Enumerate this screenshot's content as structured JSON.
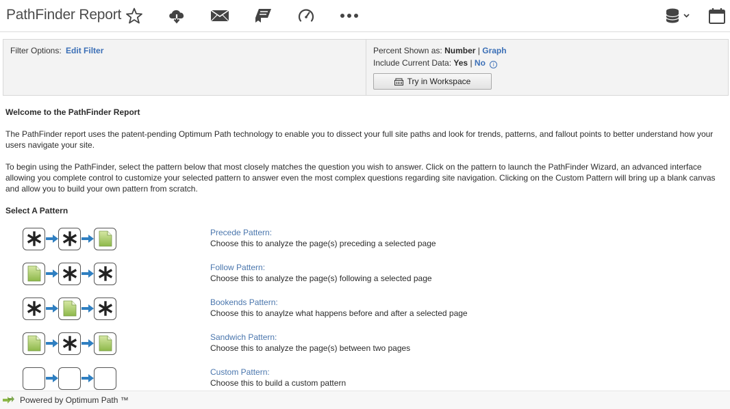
{
  "app": {
    "title": "PathFinder Report"
  },
  "toolbar": {
    "icons": [
      "star-icon",
      "cloud-download-icon",
      "mail-icon",
      "bookmark-icon",
      "gauge-icon",
      "more-icon",
      "database-icon",
      "calendar-icon"
    ]
  },
  "filter": {
    "label": "Filter Options:",
    "edit_link": "Edit Filter",
    "percent_label": "Percent Shown as:",
    "percent_number": "Number",
    "percent_sep": "|",
    "percent_graph": "Graph",
    "current_label": "Include Current Data:",
    "current_yes": "Yes",
    "current_sep": "|",
    "current_no": "No",
    "info_glyph": "i",
    "workspace_button": "Try in Workspace"
  },
  "content": {
    "welcome_heading": "Welcome to the PathFinder Report",
    "para1": "The PathFinder report uses the patent-pending Optimum Path technology to enable you to dissect your full site paths and look for trends, patterns, and fallout points to better understand how your users navigate your site.",
    "para2": "To begin using the PathFinder, select the pattern below that most closely matches the question you wish to answer. Click on the pattern to launch the PathFinder Wizard, an advanced interface allowing you complete control to customize your selected pattern to answer even the most complex questions regarding site navigation. Clicking on the Custom Pattern will bring up a blank canvas and allow you to build your own pattern from scratch.",
    "select_heading": "Select A Pattern"
  },
  "patterns": [
    {
      "name": "Precede Pattern:",
      "desc": "Choose this to analyze the page(s) preceding a selected page",
      "boxes": [
        "any",
        "any",
        "page"
      ]
    },
    {
      "name": "Follow Pattern:",
      "desc": "Choose this to analyze the page(s) following a selected page",
      "boxes": [
        "page",
        "any",
        "any"
      ]
    },
    {
      "name": "Bookends Pattern:",
      "desc": "Choose this to anaylze what happens before and after a selected page",
      "boxes": [
        "any",
        "page",
        "any"
      ]
    },
    {
      "name": "Sandwich Pattern:",
      "desc": "Choose this to analyze the page(s) between two pages",
      "boxes": [
        "page",
        "any",
        "page"
      ]
    },
    {
      "name": "Custom Pattern:",
      "desc": "Choose this to build a custom pattern",
      "boxes": [
        "empty",
        "empty",
        "empty"
      ]
    }
  ],
  "colors": {
    "link": "#3b6fb6",
    "arrow": "#2f7fc1",
    "page_green_light": "#d6e8a4",
    "page_green_dark": "#8db84a"
  },
  "footer": {
    "text": "Powered by Optimum Path ™"
  }
}
